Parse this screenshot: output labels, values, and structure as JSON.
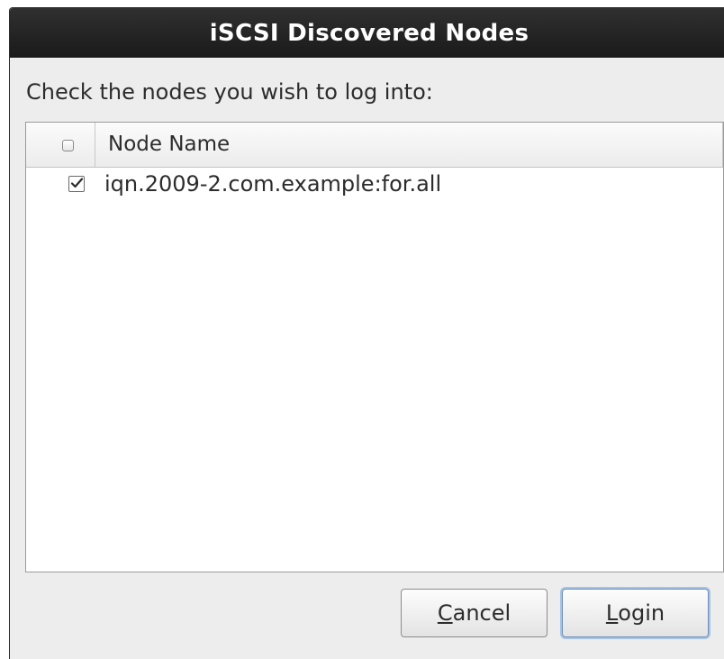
{
  "dialog": {
    "title": "iSCSI Discovered Nodes",
    "prompt": "Check the nodes you wish to log into:"
  },
  "table": {
    "header_select_all_checked": false,
    "column_header": "Node Name",
    "rows": [
      {
        "checked": true,
        "name": "iqn.2009-2.com.example:for.all"
      }
    ]
  },
  "buttons": {
    "cancel_mnemonic": "C",
    "cancel_rest": "ancel",
    "login_mnemonic": "L",
    "login_rest": "ogin"
  },
  "colors": {
    "titlebar": "#1f1f1f",
    "dialog_bg": "#ededed",
    "focus_ring": "#a8c3e3"
  }
}
